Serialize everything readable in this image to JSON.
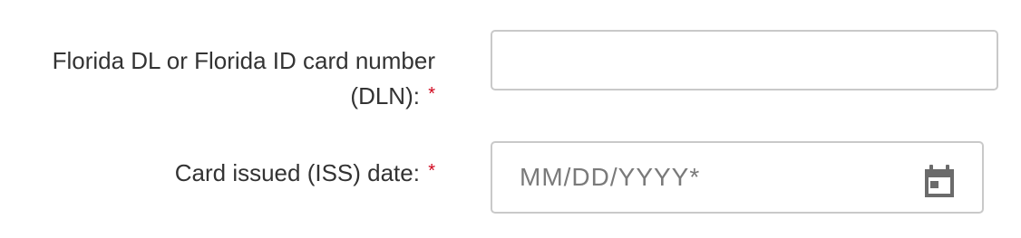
{
  "form": {
    "dln": {
      "label": "Florida DL or Florida ID card number (DLN):",
      "required_mark": "*",
      "value": "",
      "placeholder": ""
    },
    "issue_date": {
      "label": "Card issued (ISS) date:",
      "required_mark": "*",
      "value": "",
      "placeholder": "MM/DD/YYYY*",
      "icon": "calendar-icon"
    }
  },
  "colors": {
    "required": "#d0021b",
    "border": "#c9c9c9",
    "text": "#333333",
    "placeholder": "#7a7a7a",
    "icon": "#6b6b6b"
  }
}
